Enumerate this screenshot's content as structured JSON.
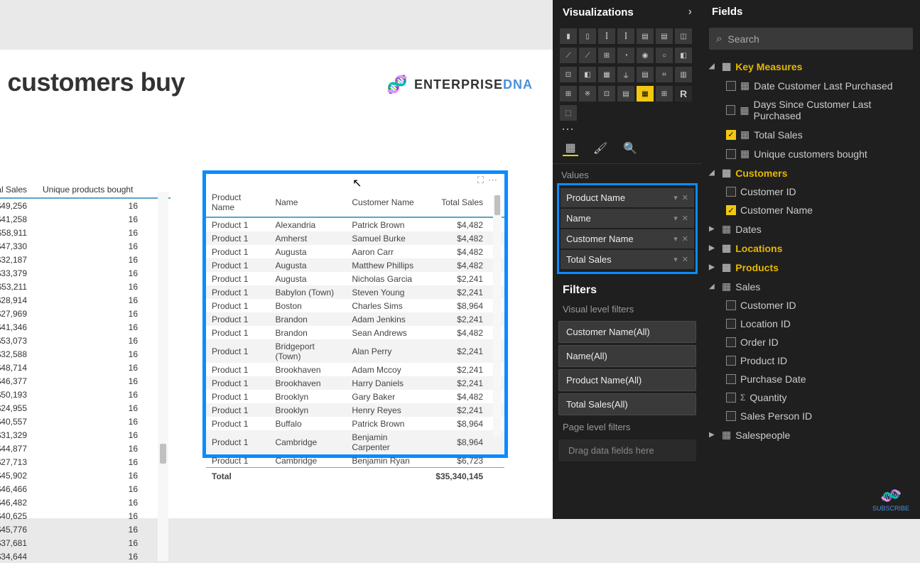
{
  "pageTitle": "id customers buy",
  "logo": {
    "brand1": "ENTERPRISE ",
    "brand2": "DNA"
  },
  "leftTable": {
    "headers": [
      "tal Sales",
      "Unique products bought"
    ],
    "rows": [
      [
        "$49,256",
        "16"
      ],
      [
        "$41,258",
        "16"
      ],
      [
        "$58,911",
        "16"
      ],
      [
        "$47,330",
        "16"
      ],
      [
        "$32,187",
        "16"
      ],
      [
        "$33,379",
        "16"
      ],
      [
        "$53,211",
        "16"
      ],
      [
        "$28,914",
        "16"
      ],
      [
        "$27,969",
        "16"
      ],
      [
        "$41,346",
        "16"
      ],
      [
        "$53,073",
        "16"
      ],
      [
        "$32,588",
        "16"
      ],
      [
        "$48,714",
        "16"
      ],
      [
        "$46,377",
        "16"
      ],
      [
        "$50,193",
        "16"
      ],
      [
        "$24,955",
        "16"
      ],
      [
        "$40,557",
        "16"
      ],
      [
        "$31,329",
        "16"
      ],
      [
        "$44,877",
        "16"
      ],
      [
        "$27,713",
        "16"
      ],
      [
        "$45,902",
        "16"
      ],
      [
        "$46,466",
        "16"
      ],
      [
        "$46,482",
        "16"
      ],
      [
        "$40,625",
        "16"
      ],
      [
        "$45,776",
        "16"
      ],
      [
        "$37,681",
        "16"
      ],
      [
        "$34,644",
        "16"
      ]
    ]
  },
  "mainTable": {
    "headers": [
      "Product Name",
      "Name",
      "Customer Name",
      "Total Sales"
    ],
    "rows": [
      [
        "Product 1",
        "Alexandria",
        "Patrick Brown",
        "$4,482"
      ],
      [
        "Product 1",
        "Amherst",
        "Samuel Burke",
        "$4,482"
      ],
      [
        "Product 1",
        "Augusta",
        "Aaron Carr",
        "$4,482"
      ],
      [
        "Product 1",
        "Augusta",
        "Matthew Phillips",
        "$4,482"
      ],
      [
        "Product 1",
        "Augusta",
        "Nicholas Garcia",
        "$2,241"
      ],
      [
        "Product 1",
        "Babylon (Town)",
        "Steven Young",
        "$2,241"
      ],
      [
        "Product 1",
        "Boston",
        "Charles Sims",
        "$8,964"
      ],
      [
        "Product 1",
        "Brandon",
        "Adam Jenkins",
        "$2,241"
      ],
      [
        "Product 1",
        "Brandon",
        "Sean Andrews",
        "$4,482"
      ],
      [
        "Product 1",
        "Bridgeport (Town)",
        "Alan Perry",
        "$2,241"
      ],
      [
        "Product 1",
        "Brookhaven",
        "Adam Mccoy",
        "$2,241"
      ],
      [
        "Product 1",
        "Brookhaven",
        "Harry Daniels",
        "$2,241"
      ],
      [
        "Product 1",
        "Brooklyn",
        "Gary Baker",
        "$4,482"
      ],
      [
        "Product 1",
        "Brooklyn",
        "Henry Reyes",
        "$2,241"
      ],
      [
        "Product 1",
        "Buffalo",
        "Patrick Brown",
        "$8,964"
      ],
      [
        "Product 1",
        "Cambridge",
        "Benjamin Carpenter",
        "$8,964"
      ],
      [
        "Product 1",
        "Cambridge",
        "Benjamin Ryan",
        "$6,723"
      ]
    ],
    "totalLabel": "Total",
    "totalValue": "$35,340,145"
  },
  "vizPanel": {
    "title": "Visualizations",
    "valuesLabel": "Values",
    "wells": [
      "Product Name",
      "Name",
      "Customer Name",
      "Total Sales"
    ],
    "filtersTitle": "Filters",
    "visualFiltersLabel": "Visual level filters",
    "filterPills": [
      "Customer Name(All)",
      "Name(All)",
      "Product Name(All)",
      "Total Sales(All)"
    ],
    "pageFiltersLabel": "Page level filters",
    "dropHint": "Drag data fields here"
  },
  "fieldsPanel": {
    "title": "Fields",
    "searchPlaceholder": "Search",
    "tree": [
      {
        "type": "table",
        "label": "Key Measures",
        "gold": true,
        "expanded": true,
        "children": [
          {
            "label": "Date Customer Last Purchased",
            "checked": false,
            "icon": "calc"
          },
          {
            "label": "Days Since Customer Last Purchased",
            "checked": false,
            "icon": "calc"
          },
          {
            "label": "Total Sales",
            "checked": true,
            "icon": "calc"
          },
          {
            "label": "Unique customers bought",
            "checked": false,
            "icon": "calc"
          }
        ]
      },
      {
        "type": "table",
        "label": "Customers",
        "gold": true,
        "expanded": true,
        "children": [
          {
            "label": "Customer ID",
            "checked": false
          },
          {
            "label": "Customer Name",
            "checked": true
          }
        ]
      },
      {
        "type": "table",
        "label": "Dates",
        "gold": false,
        "expanded": false
      },
      {
        "type": "table",
        "label": "Locations",
        "gold": true,
        "expanded": false
      },
      {
        "type": "table",
        "label": "Products",
        "gold": true,
        "expanded": false
      },
      {
        "type": "table",
        "label": "Sales",
        "gold": false,
        "expanded": true,
        "children": [
          {
            "label": "Customer ID",
            "checked": false
          },
          {
            "label": "Location ID",
            "checked": false
          },
          {
            "label": "Order ID",
            "checked": false
          },
          {
            "label": "Product ID",
            "checked": false
          },
          {
            "label": "Purchase Date",
            "checked": false
          },
          {
            "label": "Quantity",
            "checked": false,
            "icon": "sigma"
          },
          {
            "label": "Sales Person ID",
            "checked": false
          }
        ]
      },
      {
        "type": "table",
        "label": "Salespeople",
        "gold": false,
        "expanded": false
      }
    ]
  },
  "subscribe": "SUBSCRIBE"
}
